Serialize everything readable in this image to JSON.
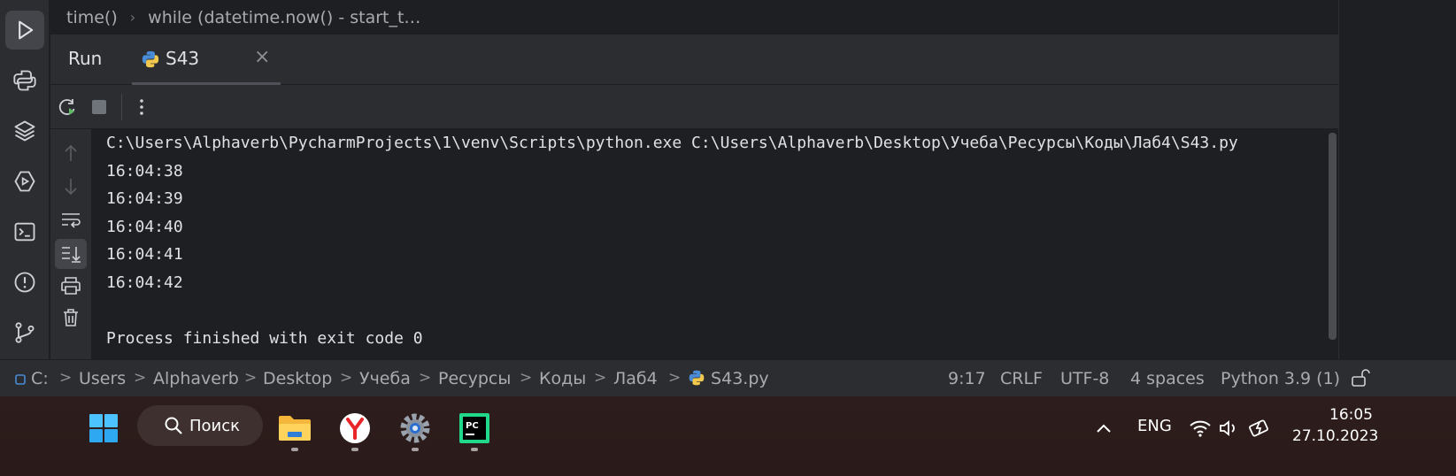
{
  "top_breadcrumb": [
    "time()",
    "while (datetime.now() - start_t…"
  ],
  "run_panel": {
    "title": "Run",
    "tab_name": "S43",
    "tab_close": "×"
  },
  "console_lines": [
    "C:\\Users\\Alphaverb\\PycharmProjects\\1\\venv\\Scripts\\python.exe C:\\Users\\Alphaverb\\Desktop\\Учеба\\Ресурсы\\Коды\\Лаб4\\S43.py",
    "16:04:38",
    "16:04:39",
    "16:04:40",
    "16:04:41",
    "16:04:42",
    "",
    "Process finished with exit code 0"
  ],
  "statusbar": {
    "path": [
      "C:",
      "Users",
      "Alphaverb",
      "Desktop",
      "Учеба",
      "Ресурсы",
      "Коды",
      "Лаб4",
      "S43.py"
    ],
    "position": "9:17",
    "line_ending": "CRLF",
    "encoding": "UTF-8",
    "indent": "4 spaces",
    "interpreter": "Python 3.9 (1)"
  },
  "taskbar": {
    "search_label": "Поиск",
    "language": "ENG",
    "time": "16:05",
    "date": "27.10.2023"
  },
  "colors": {
    "ide_bg": "#1e1f22",
    "panel_bg": "#2b2d30",
    "text": "#dfe1e5",
    "muted": "#a9abb0",
    "taskbar_bg": "#2b1b1a"
  }
}
